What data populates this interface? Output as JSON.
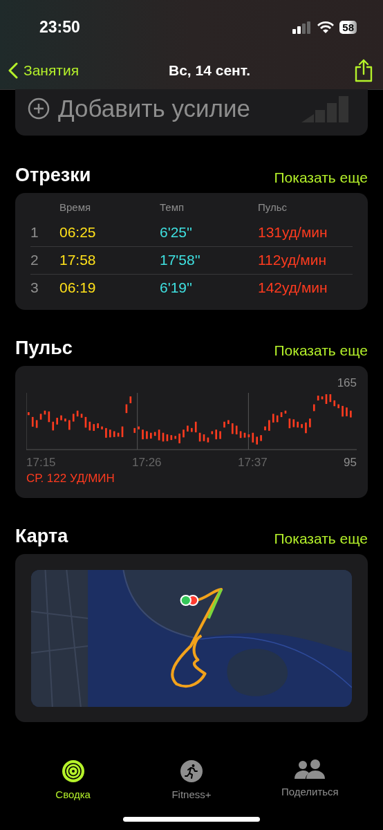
{
  "status_bar": {
    "time": "23:50",
    "battery": "58"
  },
  "nav": {
    "back": "Занятия",
    "title": "Вс, 14 сент."
  },
  "add_effort": {
    "label": "Добавить усилие"
  },
  "splits": {
    "title": "Отрезки",
    "more": "Показать еще",
    "columns": [
      "Время",
      "Темп",
      "Пульс"
    ],
    "rows": [
      {
        "index": "1",
        "time": "06:25",
        "pace": "6'25''",
        "pulse": "131уд/мин"
      },
      {
        "index": "2",
        "time": "17:58",
        "pace": "17'58''",
        "pulse": "112уд/мин"
      },
      {
        "index": "3",
        "time": "06:19",
        "pace": "6'19''",
        "pulse": "142уд/мин"
      }
    ]
  },
  "heart_rate": {
    "title": "Пульс",
    "more": "Показать еще",
    "y_max": "165",
    "y_min": "95",
    "x_labels": [
      "17:15",
      "17:26",
      "17:37"
    ],
    "average": "СР. 122 УД/МИН"
  },
  "map": {
    "title": "Карта",
    "more": "Показать еще",
    "kind": "picture"
  },
  "tab_bar": [
    {
      "label": "Сводка",
      "selected": true,
      "kind": "rings"
    },
    {
      "label": "Fitness+",
      "selected": false,
      "kind": "runner"
    },
    {
      "label": "Поделиться",
      "selected": false,
      "kind": "people"
    }
  ]
}
